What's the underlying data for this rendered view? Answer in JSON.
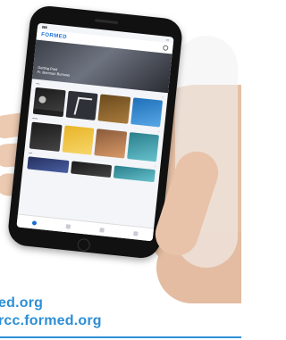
{
  "app": {
    "logo": "FORMED",
    "hero_line_1": "Getting Past",
    "hero_line_2": "Fr. Brennan Burrows"
  },
  "text": {
    "url_fragment": "ed.org",
    "url_full": "rcc.formed.org"
  },
  "colors": {
    "accent": "#2d8fd6",
    "app_blue": "#1b6fd1",
    "skin": "#e9c6ae"
  },
  "icons": {
    "tab_bar": [
      "home-icon",
      "grid-icon",
      "search-icon",
      "heart-icon"
    ]
  }
}
